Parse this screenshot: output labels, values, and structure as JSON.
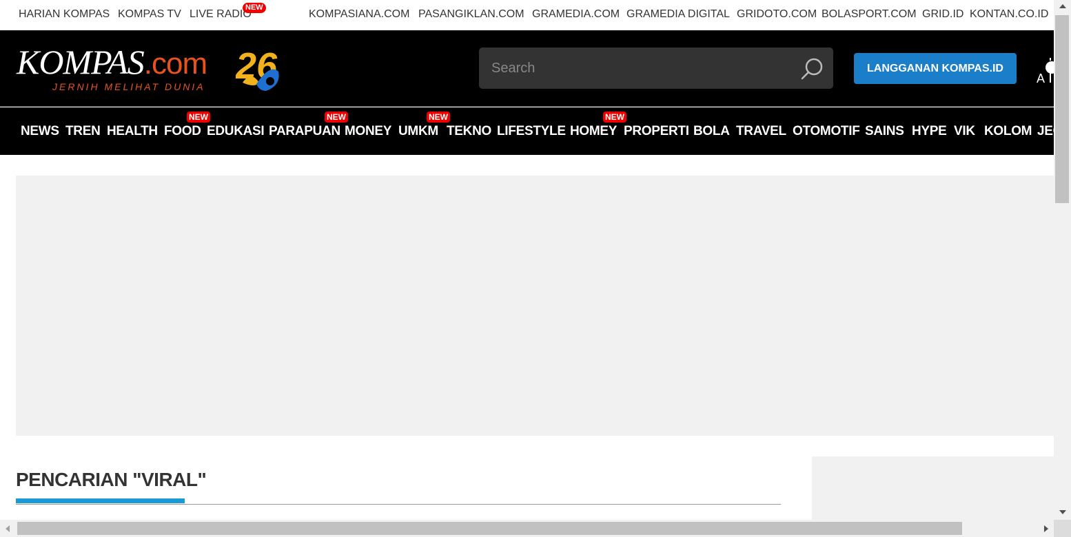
{
  "topbar": {
    "left_links": [
      "HARIAN KOMPAS",
      "KOMPAS TV",
      "LIVE RADIO"
    ],
    "live_radio_badge": "NEW",
    "right_links": [
      "KOMPASIANA.COM",
      "PASANGIKLAN.COM",
      "GRAMEDIA.COM",
      "GRAMEDIA DIGITAL",
      "GRIDOTO.COM",
      "BOLASPORT.COM",
      "GRID.ID",
      "KONTAN.CO.ID"
    ]
  },
  "header": {
    "logo_main": "KOMPAS",
    "logo_suffix": ".com",
    "tagline": "JERNIH MELIHAT DUNIA",
    "anniversary": "26",
    "search_placeholder": "Search",
    "subscribe_label": "LANGGANAN KOMPAS.ID",
    "a11y_label": "A"
  },
  "nav": {
    "items": [
      {
        "label": "NEWS"
      },
      {
        "label": "TREN"
      },
      {
        "label": "HEALTH"
      },
      {
        "label": "FOOD",
        "badge": "NEW"
      },
      {
        "label": "EDUKASI"
      },
      {
        "label": "PARAPUAN",
        "badge": "NEW"
      },
      {
        "label": "MONEY"
      },
      {
        "label": "UMKM",
        "badge": "NEW"
      },
      {
        "label": "TEKNO"
      },
      {
        "label": "LIFESTYLE"
      },
      {
        "label": "HOMEY",
        "badge": "NEW"
      },
      {
        "label": "PROPERTI"
      },
      {
        "label": "BOLA"
      },
      {
        "label": "TRAVEL"
      },
      {
        "label": "OTOMOTIF"
      },
      {
        "label": "SAINS"
      },
      {
        "label": "HYPE"
      },
      {
        "label": "VIK"
      },
      {
        "label": "KOLOM"
      },
      {
        "label": "JEO"
      }
    ]
  },
  "main": {
    "section_title": "PENCARIAN \"VIRAL\""
  },
  "colors": {
    "brand_orange": "#e8531d",
    "accent_blue": "#1a7ec8",
    "underline_blue": "#1a9ad6",
    "badge_red": "#e00000"
  }
}
